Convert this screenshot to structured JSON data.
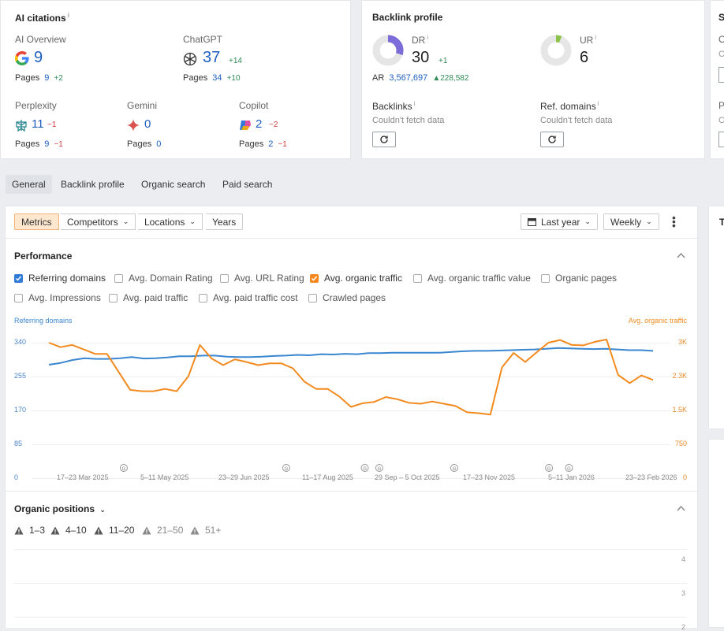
{
  "ai_citations": {
    "title": "AI citations",
    "info": "i",
    "ai_overview": {
      "label": "AI Overview",
      "value": "9",
      "pages_label": "Pages",
      "pages": "9",
      "pages_delta": "+2"
    },
    "chatgpt": {
      "label": "ChatGPT",
      "value": "37",
      "delta": "+14",
      "pages_label": "Pages",
      "pages": "34",
      "pages_delta": "+10"
    },
    "perplexity": {
      "label": "Perplexity",
      "value": "11",
      "delta": "−1",
      "pages_label": "Pages",
      "pages": "9",
      "pages_delta": "−1"
    },
    "gemini": {
      "label": "Gemini",
      "value": "0",
      "pages_label": "Pages",
      "pages": "0"
    },
    "copilot": {
      "label": "Copilot",
      "value": "2",
      "delta": "−2",
      "pages_label": "Pages",
      "pages": "2",
      "pages_delta": "−1"
    }
  },
  "backlink_profile": {
    "title": "Backlink profile",
    "dr": {
      "label": "DR",
      "info": "i",
      "value": "30",
      "delta": "+1",
      "fill": 0.3
    },
    "ur": {
      "label": "UR",
      "info": "i",
      "value": "6",
      "fill": 0.06
    },
    "ar": {
      "label": "AR",
      "value": "3,567,697",
      "delta": "228,582"
    },
    "backlinks": {
      "label": "Backlinks",
      "info": "i",
      "status": "Couldn't fetch data"
    },
    "ref_domains": {
      "label": "Ref. domains",
      "info": "i",
      "status": "Couldn't fetch data"
    },
    "colors": {
      "dr": "#7b6cd9",
      "ur": "#8bc34a"
    }
  },
  "partial_card": {
    "title": "S",
    "r1": "O",
    "r2": "C",
    "r3": "P",
    "r4": "C"
  },
  "tabs": [
    "General",
    "Backlink profile",
    "Organic search",
    "Paid search"
  ],
  "toolbar": {
    "metrics": "Metrics",
    "competitors": "Competitors",
    "locations": "Locations",
    "years": "Years",
    "period": "Last year",
    "interval": "Weekly"
  },
  "performance": {
    "title": "Performance",
    "checkboxes": [
      {
        "label": "Referring domains",
        "checked": true
      },
      {
        "label": "Avg. Domain Rating",
        "checked": false
      },
      {
        "label": "Avg. URL Rating",
        "checked": false
      },
      {
        "label": "Avg. organic traffic",
        "checked": true
      },
      {
        "label": "Avg. organic traffic value",
        "checked": false
      },
      {
        "label": "Organic pages",
        "checked": false
      },
      {
        "label": "Avg. Impressions",
        "checked": false
      },
      {
        "label": "Avg. paid traffic",
        "checked": false
      },
      {
        "label": "Avg. paid traffic cost",
        "checked": false
      },
      {
        "label": "Crawled pages",
        "checked": false
      }
    ]
  },
  "chart_data": {
    "type": "line",
    "left_axis_label": "Referring domains",
    "right_axis_label": "Avg. organic traffic",
    "left_ticks": [
      "340",
      "255",
      "170",
      "85",
      "0"
    ],
    "right_ticks": [
      "3K",
      "2.3K",
      "1.5K",
      "750",
      "0"
    ],
    "left_ylim": [
      0,
      340
    ],
    "right_ylim": [
      0,
      3000
    ],
    "x_labels": [
      "17–23 Mar 2025",
      "5–11 May 2025",
      "23–29 Jun 2025",
      "11–17 Aug 2025",
      "29 Sep – 5 Oct 2025",
      "17–23 Nov 2025",
      "5–11 Jan 2026",
      "23–23 Feb 2026"
    ],
    "series": [
      {
        "name": "Referring domains",
        "color": "#3a86d0",
        "values": [
          310,
          315,
          323,
          328,
          326,
          326,
          328,
          331,
          327,
          328,
          330,
          333,
          333,
          335,
          335,
          332,
          331,
          331,
          332,
          334,
          335,
          337,
          336,
          339,
          338,
          340,
          339,
          342,
          342,
          343,
          343,
          343,
          343,
          343,
          345,
          347,
          348,
          348,
          349,
          350,
          351,
          352,
          354,
          356,
          355,
          354,
          353,
          354,
          352,
          350,
          350,
          348
        ]
      },
      {
        "name": "Avg. organic traffic",
        "color": "#f28a1e",
        "values": [
          3000,
          2900,
          2950,
          2850,
          2750,
          2750,
          2350,
          1950,
          1920,
          1920,
          1970,
          1920,
          2250,
          2950,
          2650,
          2500,
          2630,
          2570,
          2500,
          2540,
          2540,
          2430,
          2130,
          1970,
          1970,
          1800,
          1570,
          1650,
          1680,
          1790,
          1740,
          1660,
          1640,
          1690,
          1640,
          1590,
          1450,
          1430,
          1400,
          2450,
          2770,
          2570,
          2790,
          3000,
          3060,
          2950,
          2940,
          3020,
          3070,
          2280,
          2100,
          2270,
          2170
        ]
      }
    ],
    "annotation_marker": "G",
    "annotation_positions": [
      0.103,
      0.372,
      0.502,
      0.526,
      0.65,
      0.807,
      0.84
    ]
  },
  "organic_positions": {
    "title": "Organic positions",
    "ranges": [
      {
        "label": "1–3",
        "color": "#555555"
      },
      {
        "label": "4–10",
        "color": "#555555"
      },
      {
        "label": "11–20",
        "color": "#555555"
      },
      {
        "label": "21–50",
        "color": "#888888"
      },
      {
        "label": "51+",
        "color": "#888888"
      }
    ],
    "y_ticks": [
      "4",
      "3",
      "2"
    ]
  },
  "right_panel": {
    "title": "T"
  }
}
